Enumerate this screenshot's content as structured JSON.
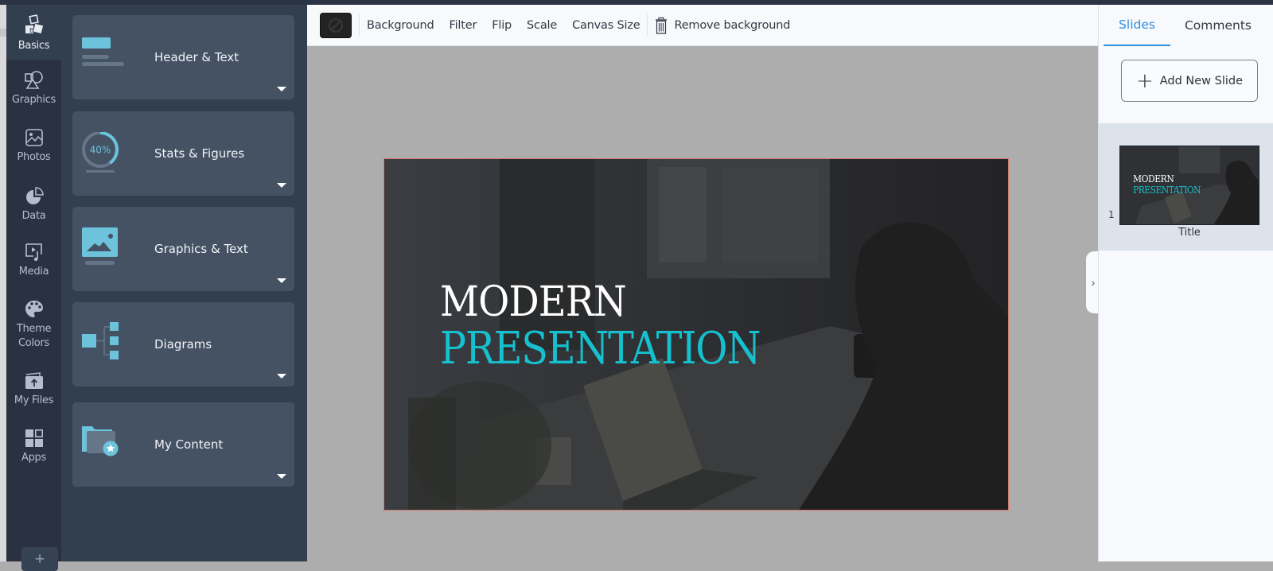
{
  "rail": {
    "items": [
      {
        "label": "Basics",
        "icon": "blocks-icon",
        "active": true
      },
      {
        "label": "Graphics",
        "icon": "shapes-icon"
      },
      {
        "label": "Photos",
        "icon": "photo-icon"
      },
      {
        "label": "Data",
        "icon": "pie-chart-icon"
      },
      {
        "label": "Media",
        "icon": "media-icon"
      },
      {
        "label": "Theme Colors",
        "icon": "palette-icon"
      },
      {
        "label": "My Files",
        "icon": "upload-folder-icon"
      },
      {
        "label": "Apps",
        "icon": "apps-grid-icon"
      }
    ],
    "add_label": "+"
  },
  "panel": {
    "cards": [
      {
        "label": "Header & Text",
        "icon": "header-text-icon"
      },
      {
        "label": "Stats & Figures",
        "icon": "stats-ring-icon",
        "icon_text": "40%"
      },
      {
        "label": "Graphics & Text",
        "icon": "graphic-image-icon"
      },
      {
        "label": "Diagrams",
        "icon": "diagram-tree-icon"
      },
      {
        "label": "My Content",
        "icon": "folder-star-icon"
      }
    ]
  },
  "toolbar": {
    "buttons": [
      "Background",
      "Filter",
      "Flip",
      "Scale",
      "Canvas Size"
    ],
    "remove_background": "Remove background"
  },
  "slide": {
    "title_line1": "MODERN",
    "title_line2": "PRESENTATION",
    "accent_color": "#16c0cf"
  },
  "right_panel": {
    "tabs": [
      {
        "label": "Slides",
        "active": true
      },
      {
        "label": "Comments",
        "active": false
      }
    ],
    "add_new_slide": "Add New Slide",
    "slides": [
      {
        "number": "1",
        "title": "Title",
        "line1": "MODERN",
        "line2": "PRESENTATION"
      }
    ],
    "collapse_glyph": "›"
  }
}
